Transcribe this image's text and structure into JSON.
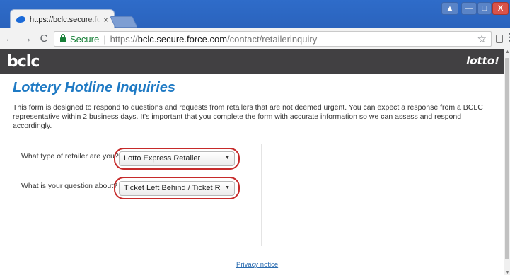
{
  "browser": {
    "tab_title": "https://bclc.secure.force.c",
    "tab_close": "×",
    "nav": {
      "back": "←",
      "forward": "→",
      "reload": "C"
    },
    "address": {
      "secure_label": "Secure",
      "separator": "|",
      "scheme": "https://",
      "host": "bclc.secure.force.com",
      "path": "/contact/retailerinquiry"
    },
    "star": "☆",
    "menu": "⋮",
    "window_controls": {
      "minimize": "—",
      "maximize": "□",
      "close": "X",
      "user": "▲"
    }
  },
  "page": {
    "brand_logo": "bclc",
    "lotto_logo": "lotto!",
    "heading": "Lottery Hotline Inquiries",
    "intro": "This form is designed to respond to questions and requests from retailers that are not deemed urgent. You can expect a response from a BCLC representative within 2 business days. It's important that you complete the form with accurate information so we can assess and respond accordingly.",
    "form": {
      "retailer_type": {
        "label": "What type of retailer are you?",
        "value": "Lotto Express Retailer"
      },
      "question_about": {
        "label": "What is your question about?",
        "value": "Ticket Left Behind / Ticket Returned"
      }
    },
    "footer": {
      "privacy_link": "Privacy notice"
    }
  },
  "colors": {
    "heading": "#1f7ac4",
    "brand_bar": "#414042",
    "highlight_ring": "#c62a2a",
    "secure_green": "#188038"
  }
}
